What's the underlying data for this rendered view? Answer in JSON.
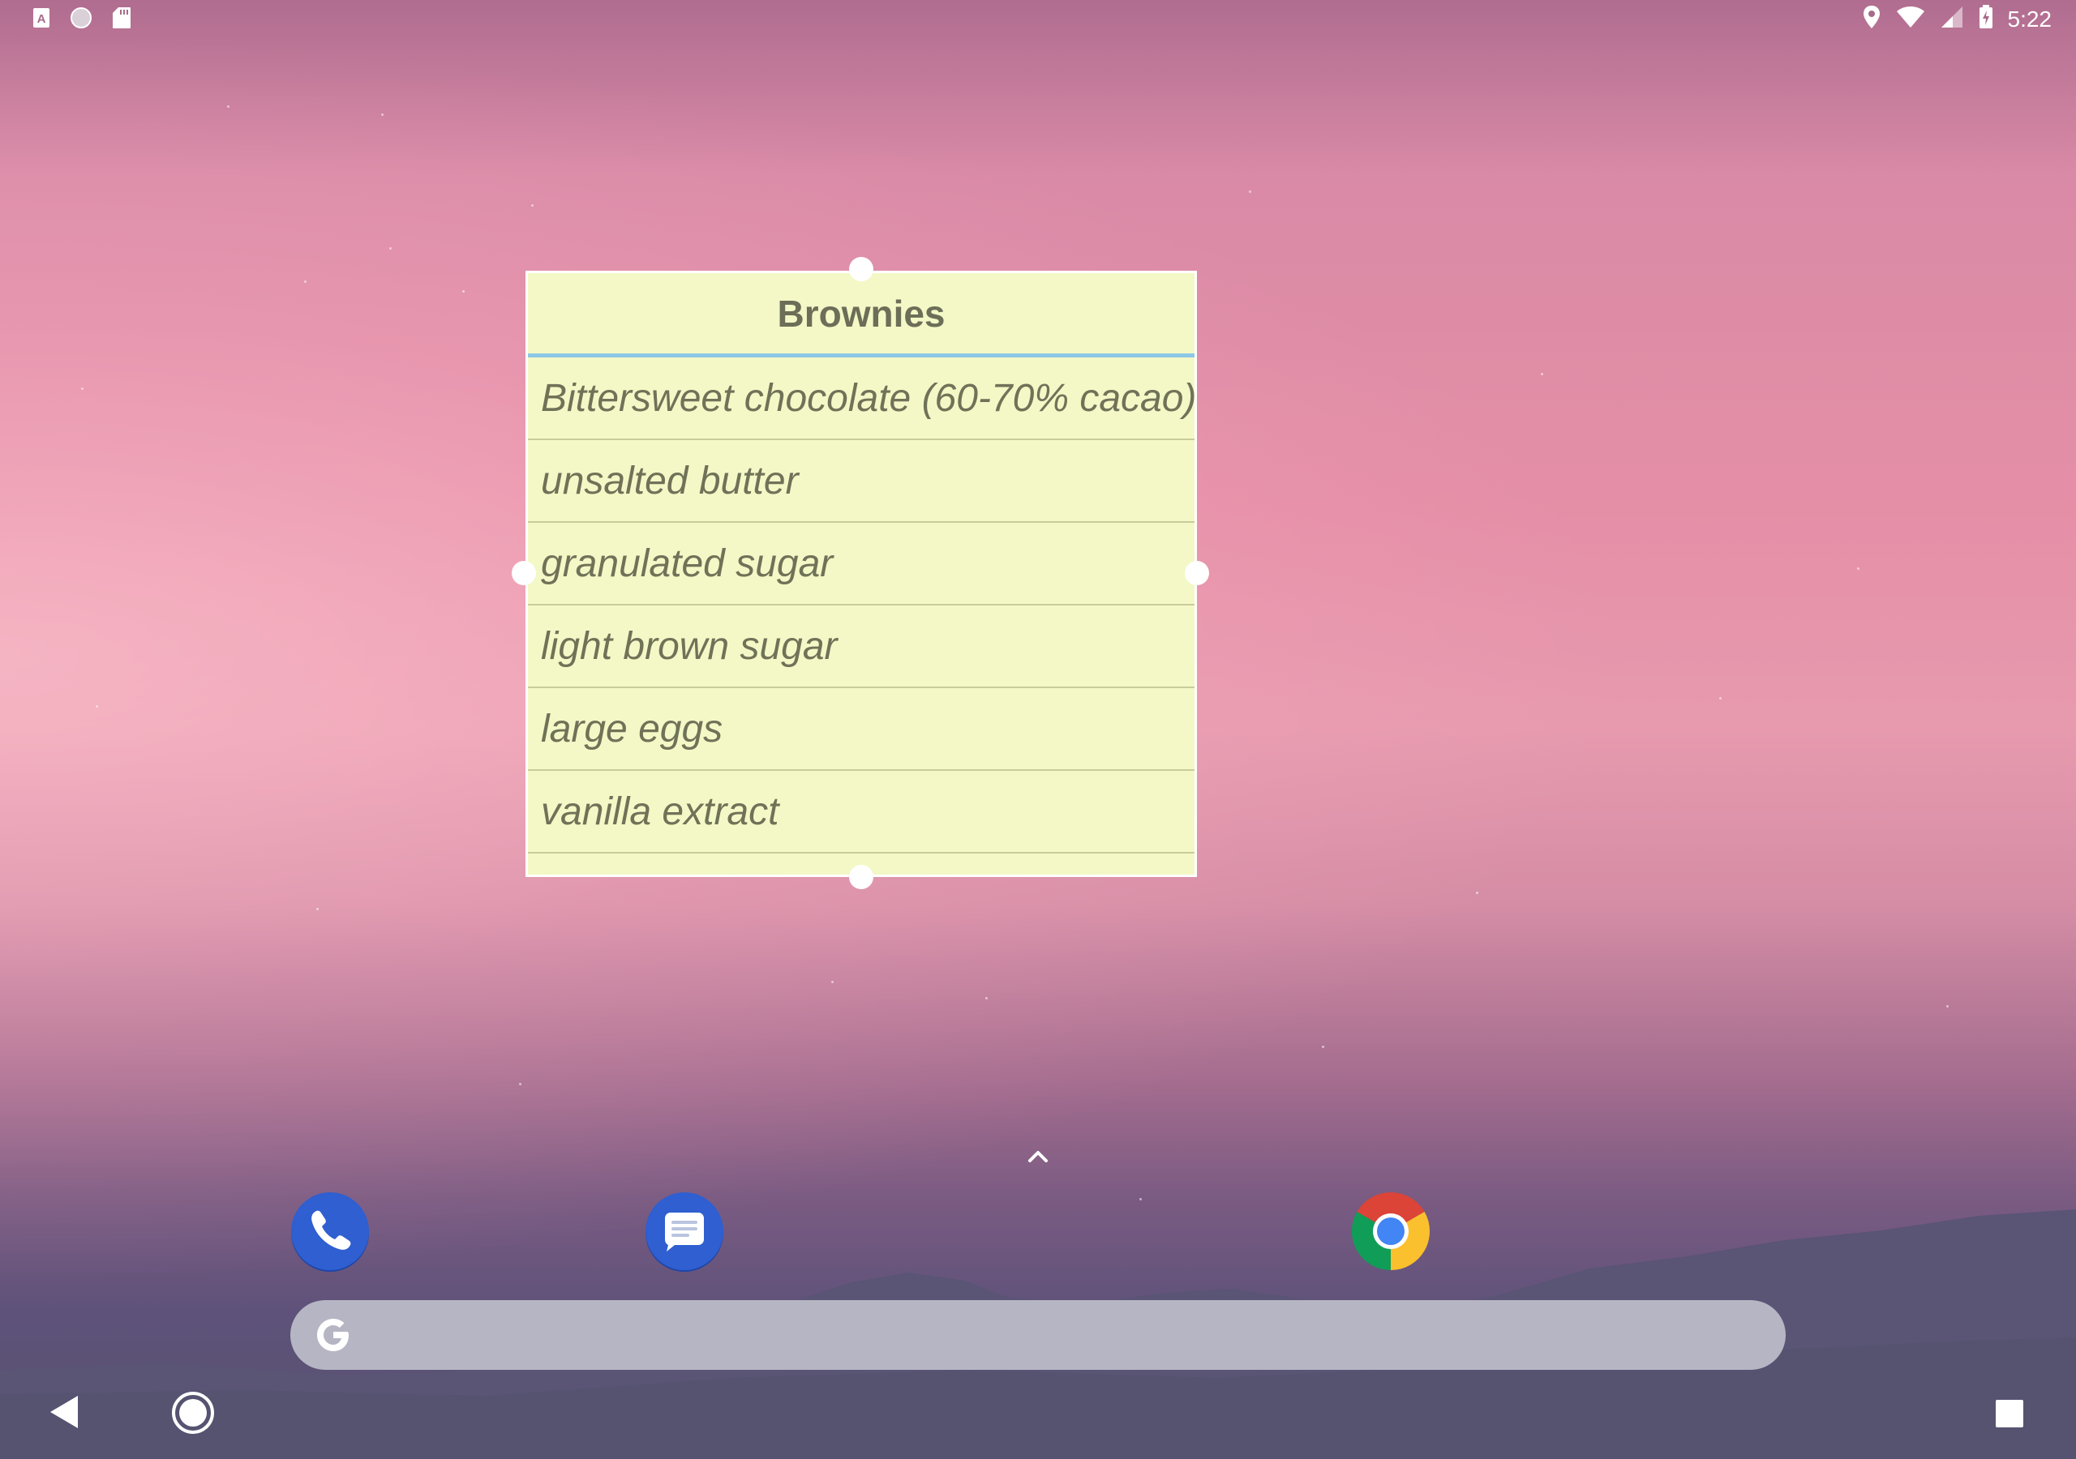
{
  "status_bar": {
    "time": "5:22",
    "left_icons": [
      "keyboard-a-icon",
      "circle-icon",
      "sd-card-icon"
    ],
    "right_icons": [
      "location-icon",
      "wifi-icon",
      "signal-icon",
      "battery-charging-icon"
    ]
  },
  "widget": {
    "title": "Brownies",
    "items": [
      "Bittersweet chocolate (60-70% cacao)",
      "unsalted butter",
      "granulated sugar",
      "light brown sugar",
      "large eggs",
      "vanilla extract"
    ]
  },
  "dock": {
    "apps": [
      "phone-icon",
      "messages-icon",
      "chrome-icon"
    ]
  },
  "search": {
    "logo": "google-g-icon"
  },
  "nav": {
    "buttons": [
      "back-button",
      "home-button",
      "recents-button"
    ]
  },
  "colors": {
    "widget_background": "#f4f8c6",
    "widget_divider": "#8cc8e6",
    "widget_text": "#707258",
    "search_bar": "#b6b5c3",
    "dock_blue": "#2f5fd0"
  }
}
